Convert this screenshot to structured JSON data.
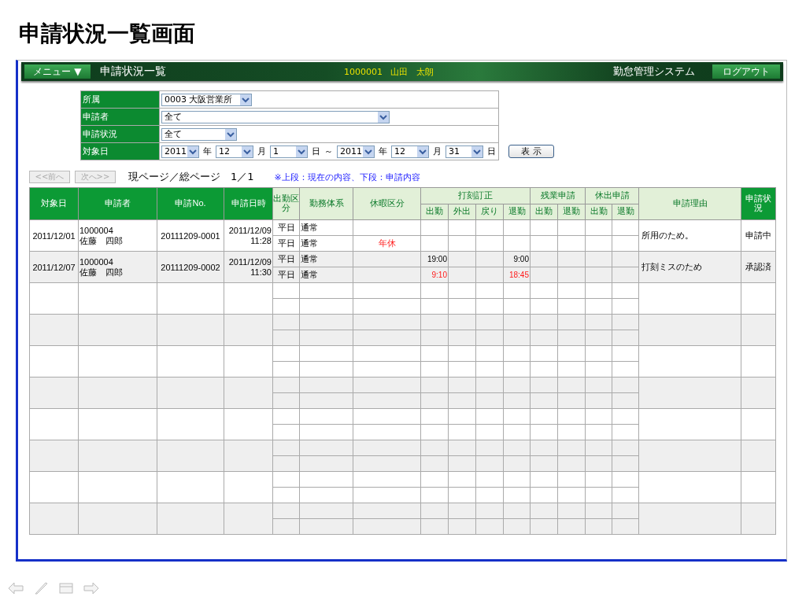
{
  "slide_title": "申請状況一覧画面",
  "header": {
    "menu_button": "メニュー ▼",
    "screen_title": "申請状況一覧",
    "user_id": "1000001",
    "user_name": "山田　太朗",
    "system_name": "勤怠管理システム",
    "logout_button": "ログアウト"
  },
  "filters": [
    {
      "label": "所属",
      "kind": "select",
      "value": "0003 大阪営業所"
    },
    {
      "label": "申請者",
      "kind": "select",
      "value": "全て"
    },
    {
      "label": "申請状況",
      "kind": "select",
      "value": "全て"
    },
    {
      "label": "対象日",
      "kind": "date_range",
      "parts": [
        {
          "kind": "select",
          "value": "2011"
        },
        {
          "kind": "unit",
          "text": "年"
        },
        {
          "kind": "select",
          "value": "12"
        },
        {
          "kind": "unit",
          "text": "月"
        },
        {
          "kind": "select",
          "value": "1"
        },
        {
          "kind": "unit",
          "text": "日"
        },
        {
          "kind": "unit",
          "text": "～"
        },
        {
          "kind": "select",
          "value": "2011"
        },
        {
          "kind": "unit",
          "text": "年"
        },
        {
          "kind": "select",
          "value": "12"
        },
        {
          "kind": "unit",
          "text": "月"
        },
        {
          "kind": "select",
          "value": "31"
        },
        {
          "kind": "unit",
          "text": "日"
        }
      ]
    }
  ],
  "show_button": "表 示",
  "pager": {
    "prev": {
      "label": "<<前へ",
      "disabled": true
    },
    "next": {
      "label": "次へ>>",
      "disabled": true
    },
    "page_info": "現ページ／総ページ　1／1",
    "note": "※上段：現在の内容、下段：申請内容"
  },
  "table": {
    "columns": [
      {
        "label": "対象日",
        "kind": "primary"
      },
      {
        "label": "申請者",
        "kind": "primary"
      },
      {
        "label": "申請No.",
        "kind": "primary"
      },
      {
        "label": "申請日時",
        "kind": "primary"
      },
      {
        "label": "出勤区分",
        "kind": "secondary"
      },
      {
        "label": "勤務体系",
        "kind": "secondary"
      },
      {
        "label": "休暇区分",
        "kind": "secondary"
      },
      {
        "label": "打刻訂正",
        "kind": "secondary",
        "children": [
          "出勤",
          "外出",
          "戻り",
          "退勤"
        ]
      },
      {
        "label": "残業申請",
        "kind": "secondary",
        "children": [
          "出勤",
          "退勤"
        ]
      },
      {
        "label": "休出申請",
        "kind": "secondary",
        "children": [
          "出勤",
          "退勤"
        ]
      },
      {
        "label": "申請理由",
        "kind": "secondary"
      },
      {
        "label": "申請状況",
        "kind": "primary"
      }
    ],
    "rows": [
      {
        "date": "2011/12/01",
        "applicant_id": "1000004",
        "applicant_name": "佐藤　四郎",
        "application_no": "20111209-0001",
        "applied_date": "2011/12/09",
        "applied_time": "11:28",
        "reason": "所用のため。",
        "status": "申請中",
        "upper": {
          "day_type": {
            "text": "平日",
            "changed": false
          },
          "work_system": {
            "text": "通常",
            "changed": false
          }
        },
        "lower": {
          "day_type": {
            "text": "平日",
            "changed": false
          },
          "work_system": {
            "text": "通常",
            "changed": false
          },
          "leave": {
            "text": "年休",
            "changed": true
          }
        }
      },
      {
        "date": "2011/12/07",
        "applicant_id": "1000004",
        "applicant_name": "佐藤　四郎",
        "application_no": "20111209-0002",
        "applied_date": "2011/12/09",
        "applied_time": "11:30",
        "reason": "打刻ミスのため",
        "status": "承認済",
        "upper": {
          "day_type": {
            "text": "平日",
            "changed": false
          },
          "work_system": {
            "text": "通常",
            "changed": false
          },
          "clock_in": {
            "text": "19:00",
            "changed": false
          },
          "clock_out": {
            "text": "9:00",
            "changed": false
          }
        },
        "lower": {
          "day_type": {
            "text": "平日",
            "changed": false
          },
          "work_system": {
            "text": "通常",
            "changed": false
          },
          "clock_in": {
            "text": "9:10",
            "changed": true
          },
          "clock_out": {
            "text": "18:45",
            "changed": true
          }
        }
      }
    ]
  }
}
